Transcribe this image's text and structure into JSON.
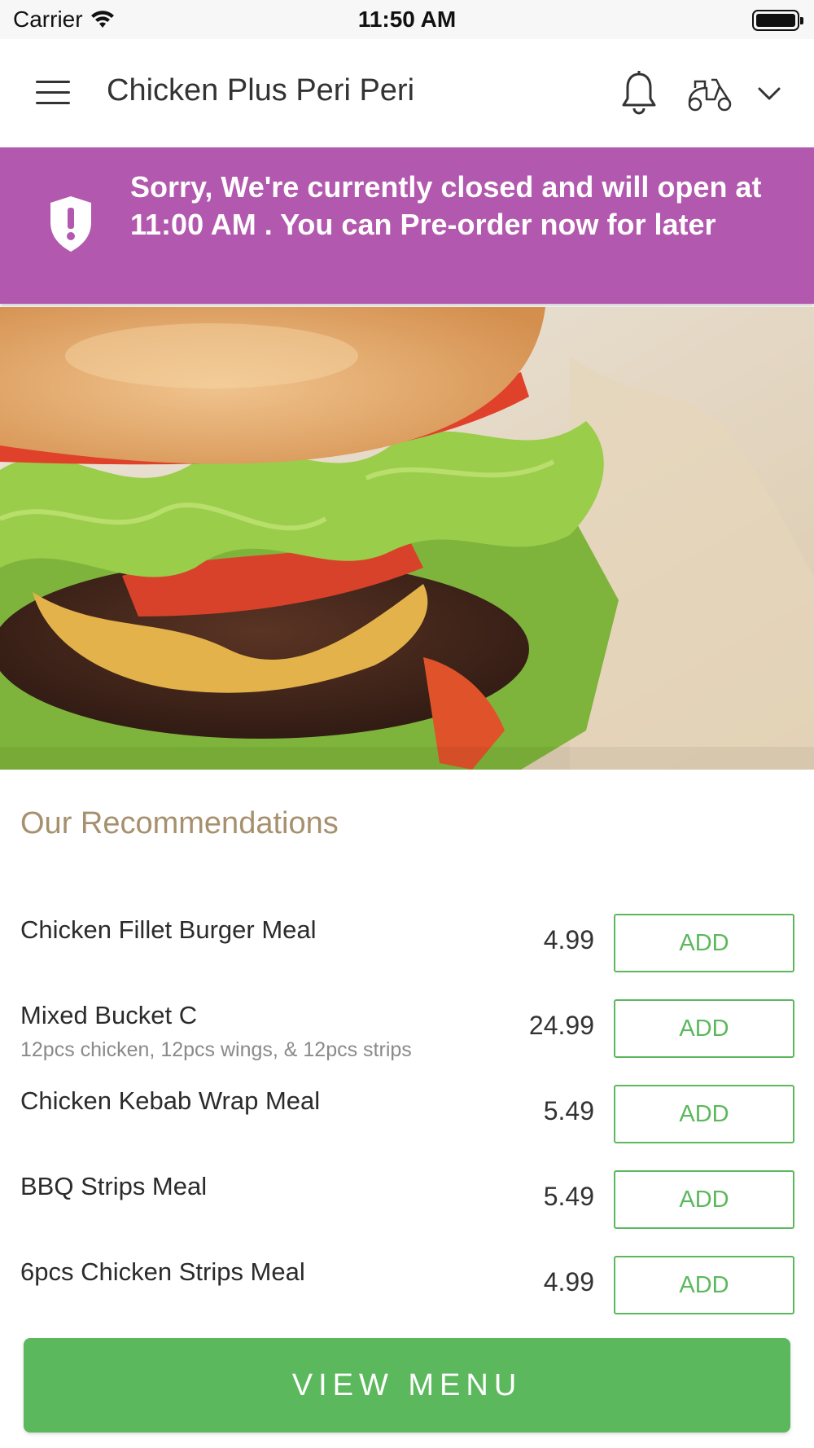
{
  "status_bar": {
    "carrier": "Carrier",
    "time": "11:50 AM"
  },
  "header": {
    "title": "Chicken Plus Peri Peri",
    "icons": [
      "menu-icon",
      "bell-icon",
      "scooter-icon",
      "chevron-down-icon"
    ]
  },
  "banner": {
    "message": "Sorry, We're currently closed and will open at 11:00 AM . You can Pre-order now for later",
    "icon": "shield-alert-icon",
    "background": "#b258ae"
  },
  "recommendations": {
    "heading": "Our Recommendations",
    "items": [
      {
        "name": "Chicken Fillet Burger Meal",
        "description": "",
        "price": "4.99",
        "button": "ADD"
      },
      {
        "name": "Mixed Bucket C",
        "description": "12pcs chicken, 12pcs wings, & 12pcs strips",
        "price": "24.99",
        "button": "ADD"
      },
      {
        "name": "Chicken Kebab Wrap Meal",
        "description": "",
        "price": "5.49",
        "button": "ADD"
      },
      {
        "name": "BBQ Strips Meal",
        "description": "",
        "price": "5.49",
        "button": "ADD"
      },
      {
        "name": "6pcs Chicken Strips Meal",
        "description": "",
        "price": "4.99",
        "button": "ADD"
      }
    ]
  },
  "footer": {
    "view_menu_label": "VIEW MENU"
  },
  "colors": {
    "accent_green": "#5cb85c",
    "banner_purple": "#b258ae",
    "heading_gold": "#a6906d"
  }
}
